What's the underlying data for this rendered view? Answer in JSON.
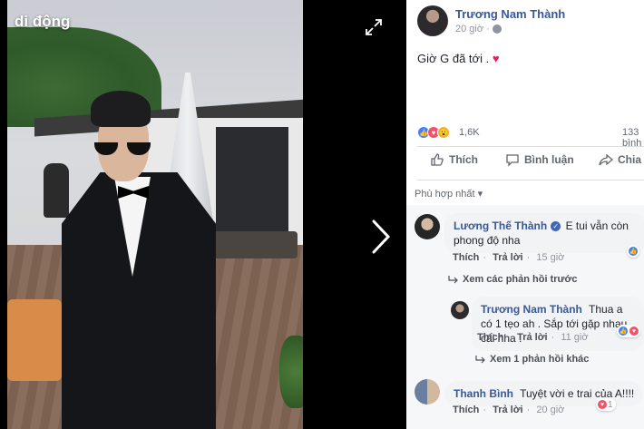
{
  "viewer": {
    "title": "di động"
  },
  "post": {
    "author": "Trương Nam Thành",
    "time": "20 giờ",
    "text": "Giờ G đã tới .",
    "heart": "♥",
    "reaction_count": "1,6K",
    "comment_count": "133 bình",
    "actions": {
      "like": "Thích",
      "comment": "Bình luận",
      "share": "Chia s"
    },
    "sort_label": "Phù hợp nhất ▾"
  },
  "comments": [
    {
      "name": "Lương Thế Thành",
      "verified": true,
      "text": "E tui vẫn còn phong độ nha",
      "like": "Thích",
      "reply": "Trả lời",
      "time": "15 giờ",
      "more_replies": "Xem các phản hồi trước"
    },
    {
      "name": "Trương Nam Thành",
      "text": "Thua a có 1 tẹo ah . Sắp tới gặp nhau cái nha .",
      "like": "Thích",
      "reply": "Trả lời",
      "time": "11 giờ",
      "more_replies": "Xem 1 phản hồi khác"
    },
    {
      "name": "Thanh Bình",
      "text": "Tuyệt vời e trai của A!!!!",
      "like": "Thích",
      "reply": "Trả lời",
      "time": "20 giờ",
      "reaction_count": "1"
    }
  ],
  "colors": {
    "link": "#385898",
    "like_blue": "#4080ff",
    "love_red": "#f25268",
    "wow_yellow": "#f7b125"
  },
  "icons": [
    "expand-icon",
    "chevron-right-icon",
    "globe-icon",
    "like-icon",
    "comment-icon",
    "share-icon",
    "verified-icon",
    "reply-arrow-icon"
  ]
}
